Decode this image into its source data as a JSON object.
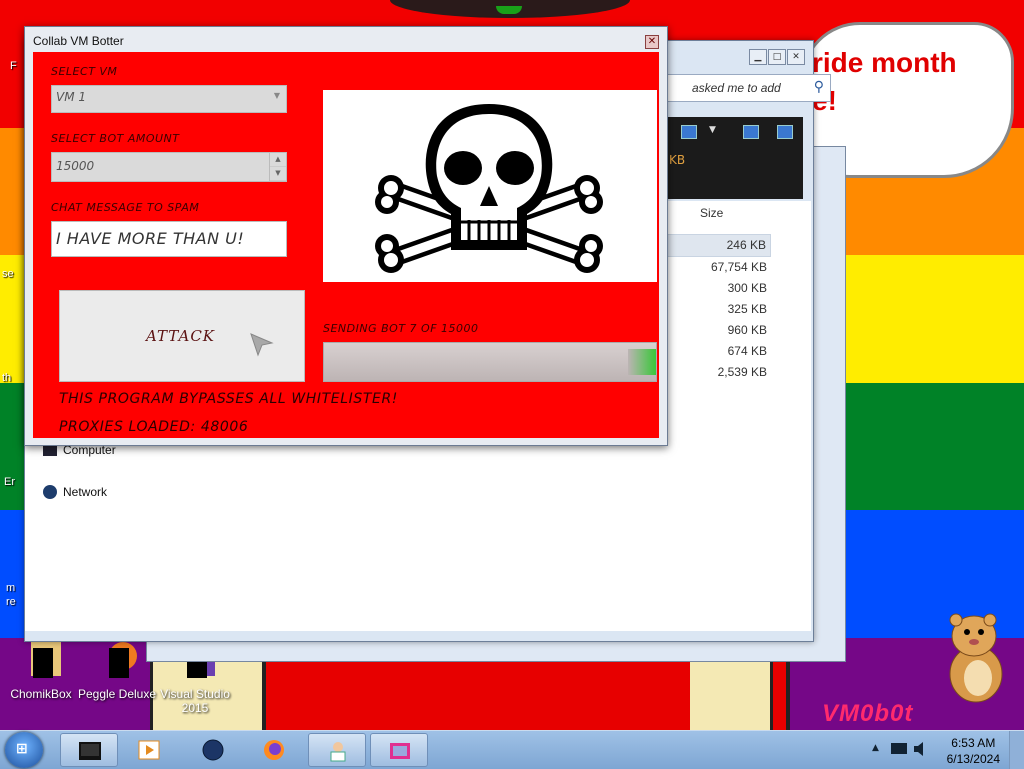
{
  "desktop": {
    "speech_bubble": [
      "ride month",
      "e!"
    ],
    "signature": "VM0b0t",
    "icons": [
      {
        "label_lines": [
          "ChomikBox"
        ]
      },
      {
        "label_lines": [
          "Peggle Deluxe"
        ]
      },
      {
        "label_lines": [
          "Visual Studio",
          "2015"
        ]
      }
    ],
    "edge_labels": [
      "F",
      "se",
      "th",
      "Er",
      "m",
      "re"
    ]
  },
  "explorer": {
    "search_placeholder": "asked me to add",
    "toolbar_fragment": "KB",
    "column_size": "Size",
    "sizes": [
      "246 KB",
      "67,754 KB",
      "300 KB",
      "325 KB",
      "960 KB",
      "674 KB",
      "2,539 KB"
    ],
    "nav": [
      "Computer",
      "Network"
    ]
  },
  "bot_window": {
    "title": "Collab VM Botter",
    "select_vm_label": "SELECT VM",
    "select_vm_value": "VM 1",
    "bot_amount_label": "SELECT BOT AMOUNT",
    "bot_amount_value": "15000",
    "chat_label": "CHAT MESSAGE TO SPAM",
    "chat_value": "I HAVE MORE THAN U!",
    "attack_label": "ATTACK",
    "status_text": "SENDING BOT 7 OF 15000",
    "progress_fraction": 0.0005,
    "warning": "THIS PROGRAM BYPASSES ALL WHITELISTER!",
    "proxies": "PROXIES LOADED: 48006"
  },
  "taskbar": {
    "time": "6:53 AM",
    "date": "6/13/2024",
    "buttons": [
      "terminal-icon",
      "media-player-icon",
      "globe-icon",
      "firefox-icon",
      "user-icon",
      "paint-icon"
    ]
  },
  "colors": {
    "bot_background": "#ff0000",
    "label_text": "#3a0000",
    "taskbar": "#9fc1e6"
  }
}
